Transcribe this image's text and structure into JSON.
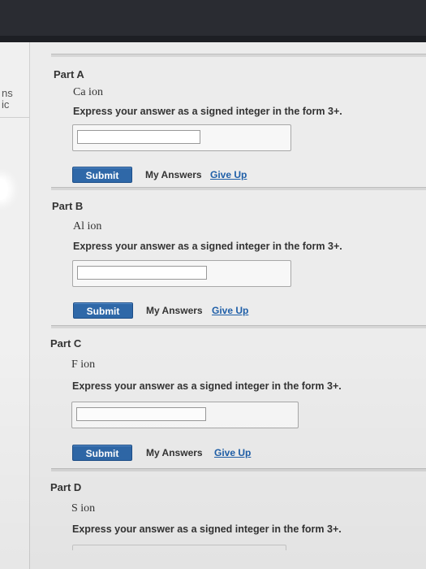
{
  "sidebar": {
    "fragment_line1": "ns",
    "fragment_line2": "ic"
  },
  "parts": [
    {
      "label": "Part A",
      "ion": "Ca ion",
      "instruction": "Express your answer as a signed integer in the form 3+.",
      "answer_value": "",
      "submit_label": "Submit",
      "my_answers_label": "My Answers",
      "give_up_label": "Give Up"
    },
    {
      "label": "Part B",
      "ion": "Al ion",
      "instruction": "Express your answer as a signed integer in the form 3+.",
      "answer_value": "",
      "submit_label": "Submit",
      "my_answers_label": "My Answers",
      "give_up_label": "Give Up"
    },
    {
      "label": "Part C",
      "ion": "F ion",
      "instruction": "Express your answer as a signed integer in the form 3+.",
      "answer_value": "",
      "submit_label": "Submit",
      "my_answers_label": "My Answers",
      "give_up_label": "Give Up"
    },
    {
      "label": "Part D",
      "ion": "S ion",
      "instruction": "Express your answer as a signed integer in the form 3+."
    }
  ],
  "colors": {
    "submit_button": "#2f68a8",
    "give_up_link": "#1f5fa8",
    "top_bar": "#2a2c32"
  }
}
